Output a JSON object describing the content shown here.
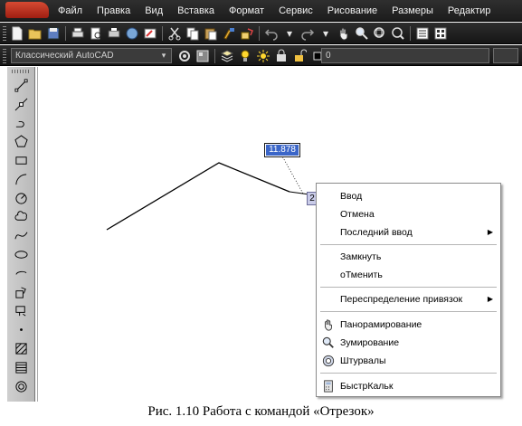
{
  "menu": {
    "items": [
      "Файл",
      "Правка",
      "Вид",
      "Вставка",
      "Формат",
      "Сервис",
      "Рисование",
      "Размеры",
      "Редактир"
    ]
  },
  "toolbar": {
    "workspace": "Классический AutoCAD",
    "layer": "0",
    "icons": [
      "new-icon",
      "open-icon",
      "save-icon",
      "print-icon",
      "preview-icon",
      "plot-icon",
      "publish-icon",
      "markup-icon",
      "cut-icon",
      "copy-icon",
      "paste-icon",
      "matchprop-icon",
      "block-icon",
      "undo-icon",
      "redo-icon",
      "pan-icon",
      "zoom-realtime-icon",
      "zoom-window-icon",
      "zoom-previous-icon",
      "properties-icon",
      "design-center-icon"
    ]
  },
  "draw_toolbar": {
    "icons": [
      "line-icon",
      "construction-line-icon",
      "polyline-icon",
      "polygon-icon",
      "rectangle-icon",
      "arc-icon",
      "circle-icon",
      "revision-cloud-icon",
      "spline-icon",
      "ellipse-icon",
      "ellipse-arc-icon",
      "insert-block-icon",
      "make-block-icon",
      "point-icon",
      "hatch-icon",
      "gradient-icon",
      "region-icon"
    ]
  },
  "drawing": {
    "dynamic_input_length": "11.878",
    "dynamic_input_angle": "2"
  },
  "context_menu": {
    "items": [
      {
        "label": "Ввод",
        "submenu": false
      },
      {
        "label": "Отмена",
        "submenu": false
      },
      {
        "label": "Последний ввод",
        "submenu": true
      },
      {
        "label": "Замкнуть",
        "submenu": false
      },
      {
        "label": "оТменить",
        "submenu": false
      },
      {
        "label": "Переспределение привязок",
        "submenu": true
      },
      {
        "label": "Панорамирование",
        "submenu": false,
        "icon": "pan-hand-icon"
      },
      {
        "label": "Зумирование",
        "submenu": false,
        "icon": "zoom-magnifier-icon"
      },
      {
        "label": "Штурвалы",
        "submenu": false,
        "icon": "steering-wheel-icon"
      },
      {
        "label": "БыстрКальк",
        "submenu": false,
        "icon": "calculator-icon"
      }
    ]
  },
  "caption": "Рис. 1.10 Работа с командой «Отрезок»"
}
